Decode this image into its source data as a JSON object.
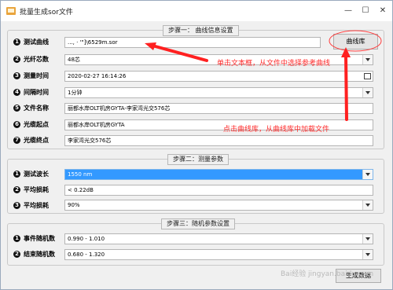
{
  "window": {
    "title": "批量生成sor文件",
    "minimize": "—",
    "maximize": "☐",
    "close": "✕"
  },
  "group1": {
    "legend": "步骤一：  曲线信息设置",
    "rows": [
      {
        "num": "1",
        "label": "测试曲线",
        "value": "..., ·  '\"]\\6529m.sor"
      },
      {
        "num": "2",
        "label": "光纤芯数",
        "value": "48芯"
      },
      {
        "num": "3",
        "label": "测量时间",
        "value": "2020-02-27 16:14:26"
      },
      {
        "num": "4",
        "label": "间隔时间",
        "value": "1分钟"
      },
      {
        "num": "5",
        "label": "文件名称",
        "value": "丽都水岸OLT机房GYTA-李家湾光交576芯"
      },
      {
        "num": "6",
        "label": "光缆起点",
        "value": "丽都水岸OLT机房GYTA"
      },
      {
        "num": "7",
        "label": "光缆终点",
        "value": "李家湾光交576芯"
      }
    ],
    "library_button": "曲线库"
  },
  "group2": {
    "legend": "步骤二：测量参数",
    "rows": [
      {
        "num": "1",
        "label": "测试波长",
        "value": "1550 nm"
      },
      {
        "num": "2",
        "label": "平均损耗",
        "value": "< 0.22dB"
      },
      {
        "num": "3",
        "label": "平均损耗",
        "value": "90%"
      }
    ]
  },
  "group3": {
    "legend": "步骤三：随机参数设置",
    "rows": [
      {
        "num": "1",
        "label": "事件随机数",
        "value": "0.990 - 1.010"
      },
      {
        "num": "2",
        "label": "结束随机数",
        "value": "0.680 - 1.320"
      }
    ]
  },
  "generate_button": "生成数据",
  "annotations": {
    "text1": "单击文本框，从文件中选择参考曲线",
    "text2": "点击曲线库，从曲线库中加载文件",
    "color": "#ff2a2a"
  },
  "watermark": "Bai经验 jingyan.baidu.com"
}
